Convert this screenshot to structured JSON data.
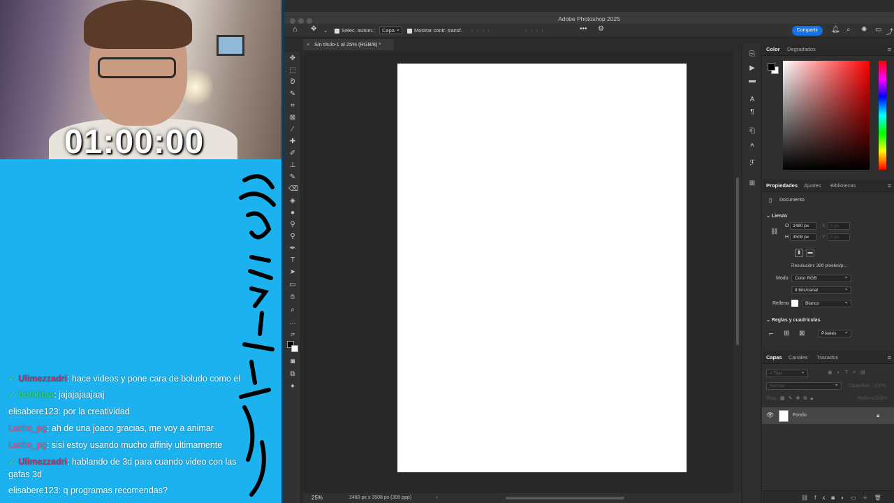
{
  "stream": {
    "timer": "01:00:00",
    "chat": [
      {
        "user": "Ulimezzadri",
        "message": "hace videos y pone cara de boludo como el",
        "badge": true,
        "user_color": "#b0305e"
      },
      {
        "user": "holikitaa",
        "message": "jajajajaajaaj",
        "badge": true,
        "user_color": "#2ed17a"
      },
      {
        "user": "elisabere123",
        "message": "por la creatividad",
        "badge": false,
        "user_color": "#ffffff"
      },
      {
        "user": "Lucho_pg",
        "message": "ah de una joaco gracias, me voy a animar",
        "badge": false,
        "user_color": "#e0507a"
      },
      {
        "user": "Lucho_pg",
        "message": "sisi estoy usando mucho affiniy ultimamente",
        "badge": false,
        "user_color": "#e0507a"
      },
      {
        "user": "Ulimezzadri",
        "message": "hablando de 3d para cuando video con las gafas 3d",
        "badge": true,
        "user_color": "#b0305e"
      },
      {
        "user": "elisabere123",
        "message": "q programas recomendas?",
        "badge": false,
        "user_color": "#ffffff"
      }
    ]
  },
  "photoshop": {
    "title": "Adobe Photoshop 2025",
    "options": {
      "auto_select_label": "Selec. autom.:",
      "auto_select_value": "Capa",
      "show_transform_label": "Mostrar contr. transf."
    },
    "share_label": "Compartir",
    "doc_tab": "Sin título-1 al 25% (RGB/8) *",
    "zoom": "25%",
    "doc_info": "2480 px x 3508 px (300 ppp)",
    "color_panel": {
      "tabs": [
        "Color",
        "Degradados"
      ]
    },
    "properties": {
      "tabs": [
        "Propiedades",
        "Ajustes",
        "Bibliotecas"
      ],
      "doc_label": "Documento",
      "canvas_section": "Lienzo",
      "w_label": "O",
      "w_value": "2480 px",
      "x_label": "X",
      "x_value": "0 px",
      "h_label": "H",
      "h_value": "3508 px",
      "y_label": "Y",
      "y_value": "0 px",
      "resolution": "Resolución: 300 píxeles/p...",
      "mode_label": "Modo",
      "mode_value": "Color RGB",
      "depth_value": "8 bits/canal",
      "fill_label": "Relleno",
      "fill_value": "Blanco",
      "rulers_section": "Reglas y cuadrículas",
      "units_value": "Píxeles"
    },
    "layers": {
      "tabs": [
        "Capas",
        "Canales",
        "Trazados"
      ],
      "search_placeholder": "Tipo",
      "blend_mode": "Normal",
      "opacity_label": "Opacidad:",
      "opacity_value": "100%",
      "lock_label": "Bloq.:",
      "fill_label": "Relleno:",
      "fill_value": "100%",
      "layer_name": "Fondo"
    }
  }
}
